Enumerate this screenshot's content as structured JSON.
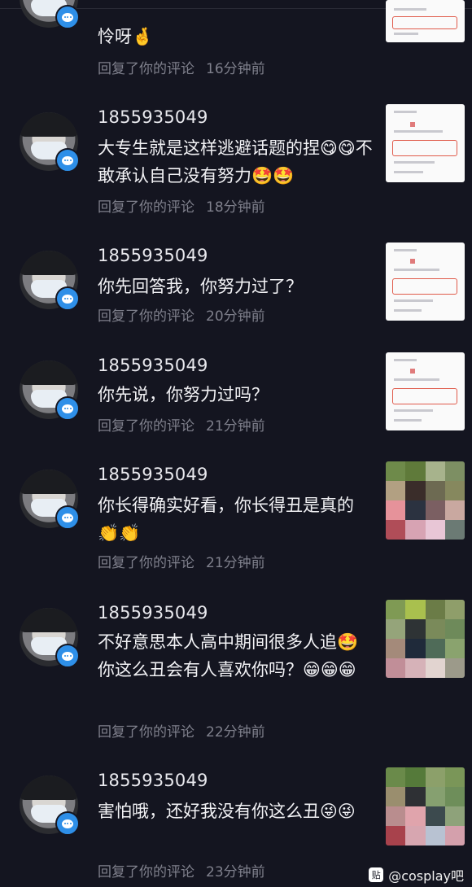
{
  "notifications": [
    {
      "username": "",
      "comment": "你们大专生没有答辩吗？😁好可怜呀🤞",
      "comment_visible_line": "怜呀🤞",
      "action": "回复了你的评论",
      "time": "16分钟前",
      "thumb": "screenshot"
    },
    {
      "username": "1855935049",
      "comment": "大专生就是这样逃避话题的捏😋😋不敢承认自己没有努力🤩🤩",
      "action": "回复了你的评论",
      "time": "18分钟前",
      "thumb": "screenshot"
    },
    {
      "username": "1855935049",
      "comment": "你先回答我，你努力过了？",
      "action": "回复了你的评论",
      "time": "20分钟前",
      "thumb": "screenshot"
    },
    {
      "username": "1855935049",
      "comment": "你先说，你努力过吗？",
      "action": "回复了你的评论",
      "time": "21分钟前",
      "thumb": "screenshot"
    },
    {
      "username": "1855935049",
      "comment": "你长得确实好看，你长得丑是真的👏👏",
      "action": "回复了你的评论",
      "time": "21分钟前",
      "thumb": "pixelated"
    },
    {
      "username": "1855935049",
      "comment": "不好意思本人高中期间很多人追🤩你这么丑会有人喜欢你吗？😁😁😁",
      "action": "回复了你的评论",
      "time": "22分钟前",
      "thumb": "pixelated"
    },
    {
      "username": "1855935049",
      "comment": "害怕哦，还好我没有你这么丑😜😜",
      "action": "回复了你的评论",
      "time": "23分钟前",
      "thumb": "pixelated"
    }
  ],
  "watermark": {
    "icon": "tieba-paw-icon",
    "text": "@cosplay吧"
  },
  "colors": {
    "background": "#141520",
    "badge": "#2e8fe8",
    "meta_text": "#7f808c"
  }
}
